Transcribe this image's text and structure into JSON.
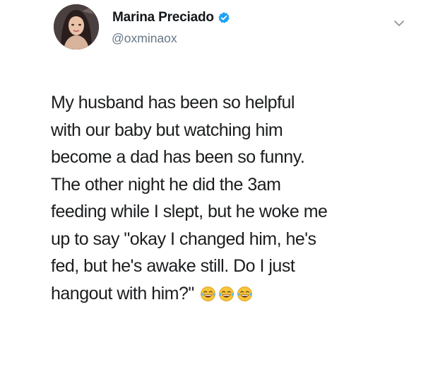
{
  "tweet": {
    "author": {
      "display_name": "Marina Preciado",
      "handle": "@oxminaox",
      "verified": true
    },
    "text_lines": [
      "My husband has been so helpful",
      "with our baby but watching him",
      "become a dad has been so funny.",
      "The other night he did the 3am",
      "feeding while I slept, but he woke me",
      "up to say \"okay I changed him, he's",
      "fed, but he's awake still. Do I just",
      "hangout with him?\""
    ],
    "emojis": [
      "tears-of-joy-icon",
      "tears-of-joy-icon",
      "tears-of-joy-icon"
    ]
  },
  "colors": {
    "text": "#14171a",
    "handle": "#657786",
    "verified_badge": "#1da1f2",
    "emoji_face": "#f7c43a"
  }
}
